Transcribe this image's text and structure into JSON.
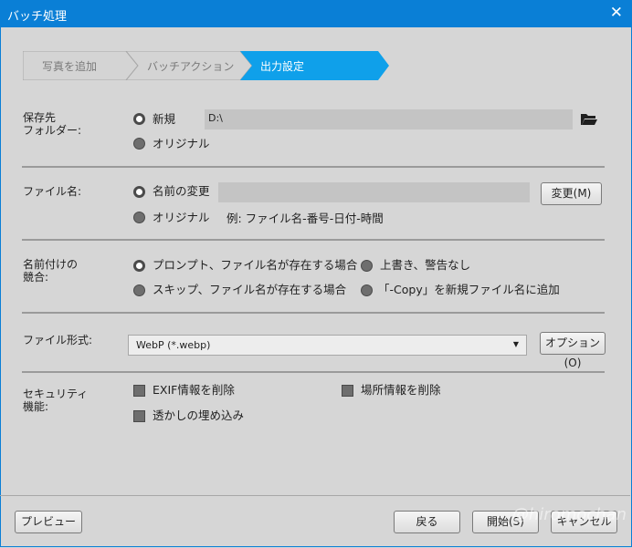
{
  "window": {
    "title": "バッチ処理"
  },
  "steps": [
    {
      "label": "写真を追加",
      "active": false
    },
    {
      "label": "バッチアクション",
      "active": false
    },
    {
      "label": "出力設定",
      "active": true
    }
  ],
  "destination": {
    "label": "保存先\nフォルダー:",
    "options": [
      {
        "label": "新規",
        "selected": true
      },
      {
        "label": "オリジナル",
        "selected": false
      }
    ],
    "path": "D:\\"
  },
  "filename": {
    "label": "ファイル名:",
    "options": [
      {
        "label": "名前の変更",
        "selected": true
      },
      {
        "label": "オリジナル",
        "selected": false
      }
    ],
    "example": "例: ファイル名-番号-日付-時間",
    "change_button": "変更(M)"
  },
  "naming_conflict": {
    "label": "名前付けの\n競合:",
    "options": [
      {
        "label": "プロンプト、ファイル名が存在する場合",
        "selected": true
      },
      {
        "label": "スキップ、ファイル名が存在する場合",
        "selected": false
      },
      {
        "label": "上書き、警告なし",
        "selected": false
      },
      {
        "label": "「-Copy」を新規ファイル名に追加",
        "selected": false
      }
    ]
  },
  "format": {
    "label": "ファイル形式:",
    "selected": "WebP (*.webp)",
    "options_button": "オプション(O)"
  },
  "security": {
    "label": "セキュリティ\n機能:",
    "checkboxes": [
      {
        "label": "EXIF情報を削除",
        "checked": false
      },
      {
        "label": "場所情報を削除",
        "checked": false
      },
      {
        "label": "透かしの埋め込み",
        "checked": false
      }
    ]
  },
  "footer": {
    "preview": "プレビュー",
    "back": "戻る",
    "start": "開始(S)",
    "cancel": "キャンセル",
    "watermark": "@hiromochan"
  },
  "colors": {
    "accent": "#0a7fd6",
    "step_active": "#0fa0ea",
    "background": "#d6d6d6"
  }
}
